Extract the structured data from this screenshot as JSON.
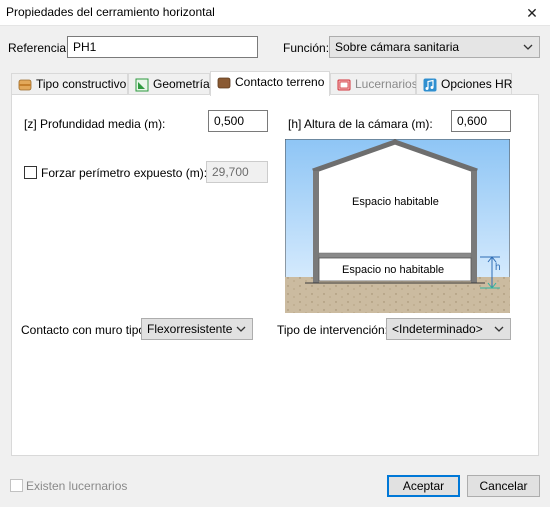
{
  "window": {
    "title": "Propiedades del cerramiento horizontal",
    "close_glyph": "✕"
  },
  "header": {
    "referencia_label": "Referencia:",
    "referencia_value": "PH1",
    "funcion_label": "Función:",
    "funcion_value": "Sobre cámara sanitaria"
  },
  "tabs": [
    {
      "label": "Tipo constructivo",
      "icon": "layers-icon",
      "color": "#d89a4a"
    },
    {
      "label": "Geometría",
      "icon": "geometry-icon",
      "color": "#2e9a3f"
    },
    {
      "label": "Contacto terreno",
      "icon": "terrain-icon",
      "color": "#8a5a33"
    },
    {
      "label": "Lucernarios",
      "icon": "skylight-icon",
      "color": "#d2333b"
    },
    {
      "label": "Opciones HR",
      "icon": "music-note-icon",
      "color": "#2f8fd0"
    }
  ],
  "contact": {
    "profundidad_label": "[z] Profundidad media (m):",
    "profundidad_value": "0,500",
    "altura_label": "[h] Altura de la cámara (m):",
    "altura_value": "0,600",
    "perimetro_label": "Forzar perímetro expuesto (m):",
    "perimetro_value": "29,700",
    "muro_label": "Contacto con muro tipo:",
    "muro_value": "Flexorresistente",
    "intervencion_label": "Tipo de intervención:",
    "intervencion_value": "<Indeterminado>"
  },
  "diagram": {
    "habitable": "Espacio habitable",
    "no_habitable": "Espacio no habitable",
    "h_marker": "h",
    "sky_color": "#bfe0ff",
    "ground_color": "#c9b89c"
  },
  "footer": {
    "lucernarios_label": "Existen lucernarios",
    "accept_label": "Aceptar",
    "cancel_label": "Cancelar"
  }
}
